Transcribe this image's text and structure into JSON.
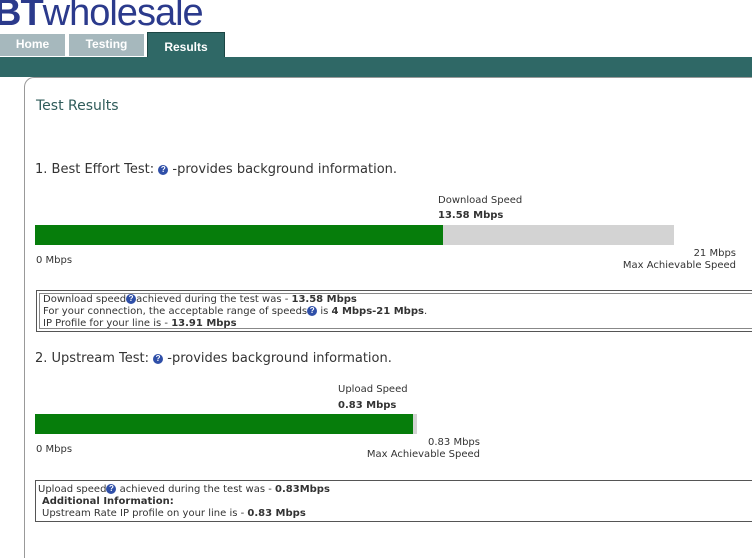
{
  "header": {
    "logo_bt": "BT",
    "logo_rest": "wholesale",
    "tabs": [
      {
        "label": "Home",
        "active": false
      },
      {
        "label": "Testing",
        "active": false
      },
      {
        "label": "Results",
        "active": true
      }
    ]
  },
  "page_title": "Test Results",
  "best_effort": {
    "heading_prefix": "1. Best Effort Test:",
    "heading_suffix": " -provides background information.",
    "speed_label": "Download  Speed",
    "speed_value": "13.58 Mbps",
    "min_label": "0 Mbps",
    "max_value": "21 Mbps",
    "max_label": "Max Achievable Speed",
    "fill_fraction": 0.639,
    "info": {
      "line1_a": "Download speed",
      "line1_b": "achieved during the test was - ",
      "line1_val": "13.58 Mbps",
      "line2_a": "For your connection, the acceptable range of speeds",
      "line2_b": " is ",
      "line2_val": "4 Mbps-21 Mbps",
      "line2_end": ".",
      "line3_a": "IP Profile for your line is - ",
      "line3_val": "13.91 Mbps"
    }
  },
  "upstream": {
    "heading_prefix": "2. Upstream Test:",
    "heading_suffix": " -provides background information.",
    "speed_label": "Upload Speed",
    "speed_value": "0.83 Mbps",
    "min_label": "0 Mbps",
    "max_value": "0.83 Mbps",
    "max_label": "Max Achievable Speed",
    "fill_fraction": 0.99,
    "info": {
      "line1_a": "Upload speed",
      "line1_b": " achieved during the test was - ",
      "line1_val": "0.83Mbps",
      "line2": "Additional Information:",
      "line3_a": "Upstream Rate IP profile on your line is - ",
      "line3_val": "0.83 Mbps"
    }
  },
  "icons": {
    "help": "question-mark-icon"
  },
  "colors": {
    "brand": "#2b3a8c",
    "nav": "#2f6866",
    "bar_fill": "#067d0b",
    "bar_bg": "#d3d3d3",
    "help_icon": "#2f4fa8"
  }
}
